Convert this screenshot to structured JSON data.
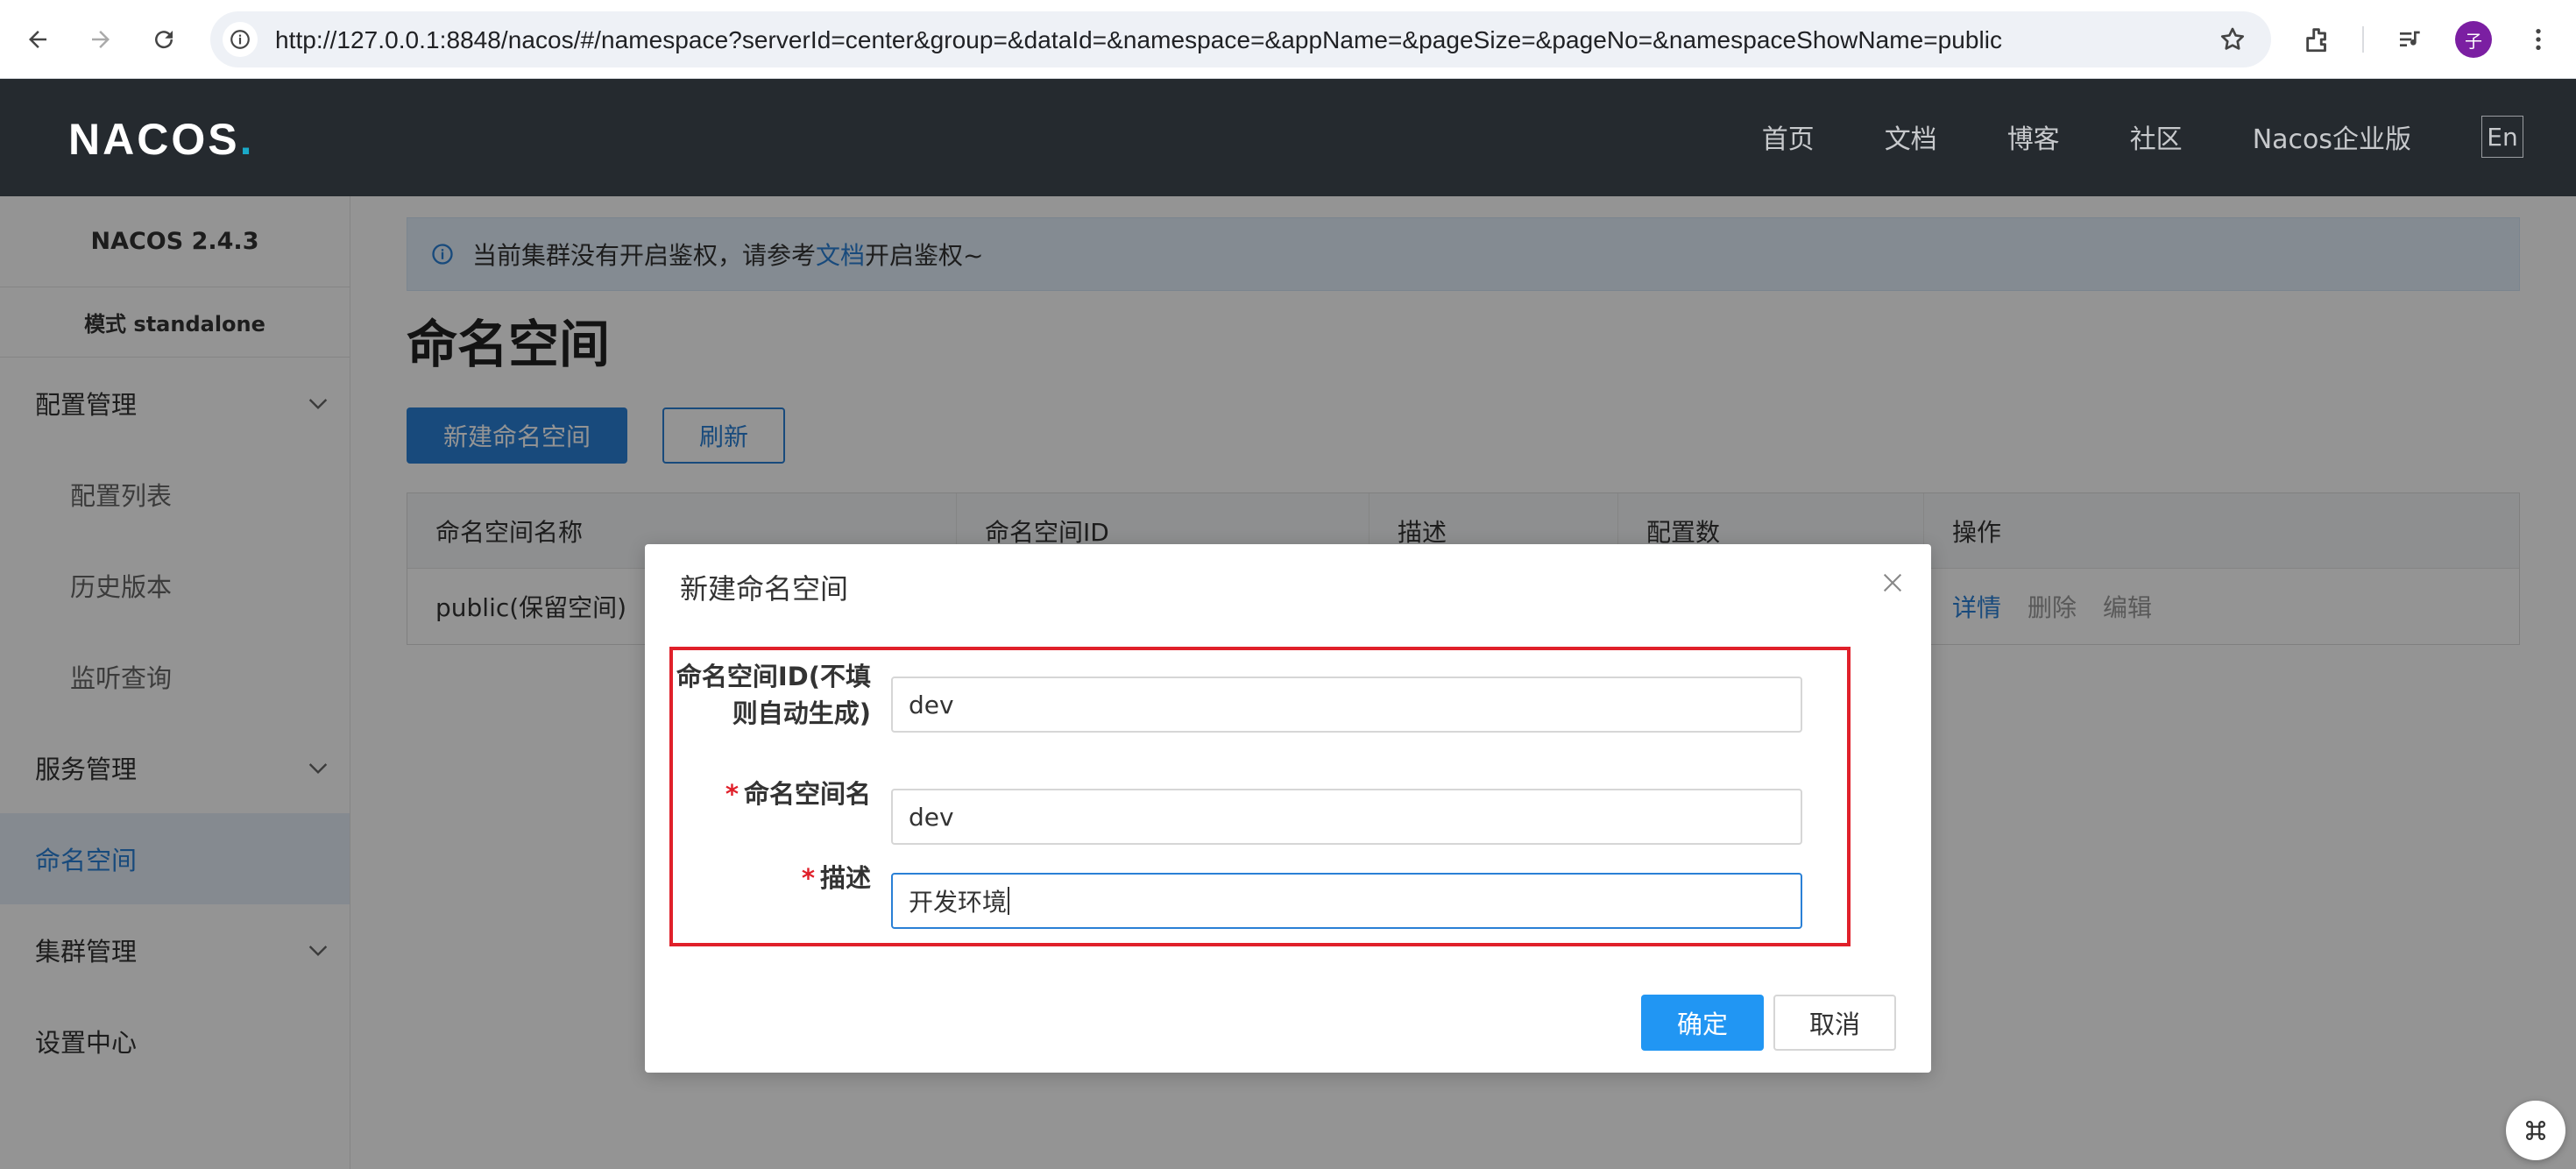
{
  "browser": {
    "url": "http://127.0.0.1:8848/nacos/#/namespace?serverId=center&group=&dataId=&namespace=&appName=&pageSize=&pageNo=&namespaceShowName=public",
    "profile_initial": "子"
  },
  "header": {
    "logo": "NACOS",
    "logo_dot": ".",
    "nav": [
      "首页",
      "文档",
      "博客",
      "社区",
      "Nacos企业版"
    ],
    "lang": "En"
  },
  "sidebar": {
    "version": "NACOS 2.4.3",
    "mode": "模式 standalone",
    "items": [
      {
        "label": "配置管理",
        "type": "group"
      },
      {
        "label": "配置列表",
        "type": "sub"
      },
      {
        "label": "历史版本",
        "type": "sub"
      },
      {
        "label": "监听查询",
        "type": "sub"
      },
      {
        "label": "服务管理",
        "type": "group"
      },
      {
        "label": "命名空间",
        "type": "active"
      },
      {
        "label": "集群管理",
        "type": "group"
      },
      {
        "label": "设置中心",
        "type": "item"
      }
    ]
  },
  "main": {
    "notice_prefix": "当前集群没有开启鉴权，请参考",
    "notice_link": "文档",
    "notice_suffix": "开启鉴权~",
    "title": "命名空间",
    "new_button": "新建命名空间",
    "refresh_button": "刷新",
    "table": {
      "headers": [
        "命名空间名称",
        "命名空间ID",
        "描述",
        "配置数",
        "操作"
      ],
      "rows": [
        {
          "name": "public(保留空间)",
          "id": "",
          "desc": "",
          "count": ""
        }
      ],
      "ops": [
        "详情",
        "删除",
        "编辑"
      ]
    }
  },
  "dialog": {
    "title": "新建命名空间",
    "id_label_line1": "命名空间ID(不填",
    "id_label_line2": "则自动生成)",
    "id_value": "dev",
    "name_label": "命名空间名",
    "name_value": "dev",
    "desc_label": "描述",
    "desc_value": "开发环境",
    "required_mark": "*",
    "ok_button": "确定",
    "cancel_button": "取消"
  },
  "colors": {
    "accent": "#2a80d6",
    "header_bg": "#252a2f",
    "highlight": "#e0202a"
  }
}
